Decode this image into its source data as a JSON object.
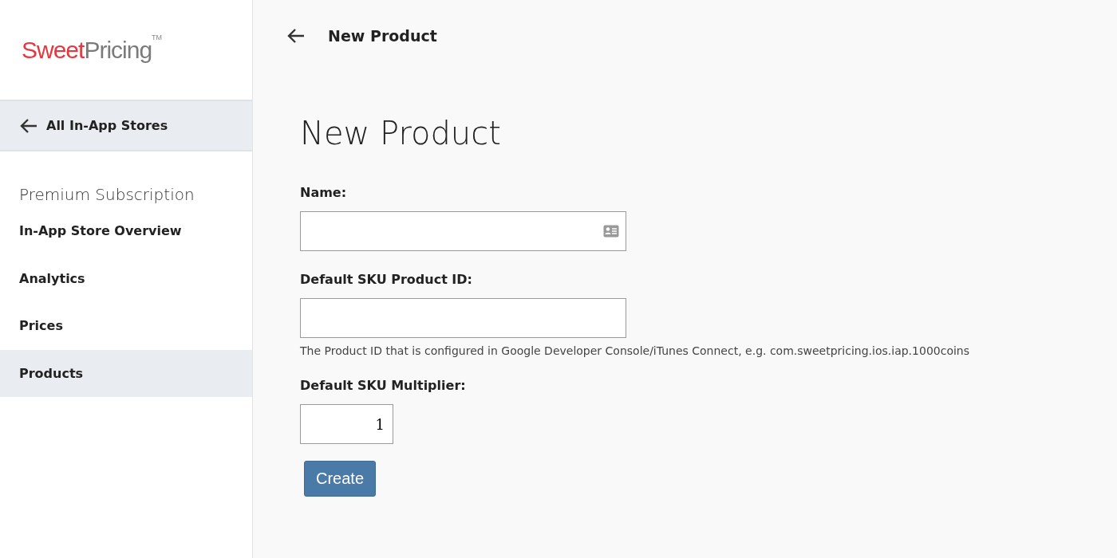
{
  "logo": {
    "first": "Sweet",
    "second": "Pricing",
    "mark": "TM"
  },
  "sidebar": {
    "back_link": "All In-App Stores",
    "section_title": "Premium Subscription",
    "items": [
      {
        "label": "In-App Store Overview",
        "selected": false
      },
      {
        "label": "Analytics",
        "selected": false
      },
      {
        "label": "Prices",
        "selected": false
      },
      {
        "label": "Products",
        "selected": true
      }
    ]
  },
  "header": {
    "title": "New Product"
  },
  "form": {
    "title": "New Product",
    "fields": [
      {
        "label": "Name:",
        "kind": "text",
        "autofill_icon": true
      },
      {
        "label": "Default SKU Product ID:",
        "kind": "text",
        "autofill_icon": false,
        "hint": "The Product ID that is configured in Google Developer Console/iTunes Connect, e.g. com.sweetpricing.ios.iap.1000coins"
      },
      {
        "label": "Default SKU Multiplier:",
        "kind": "number",
        "autofill_icon": false,
        "value": "1"
      }
    ],
    "submit": "Create"
  }
}
